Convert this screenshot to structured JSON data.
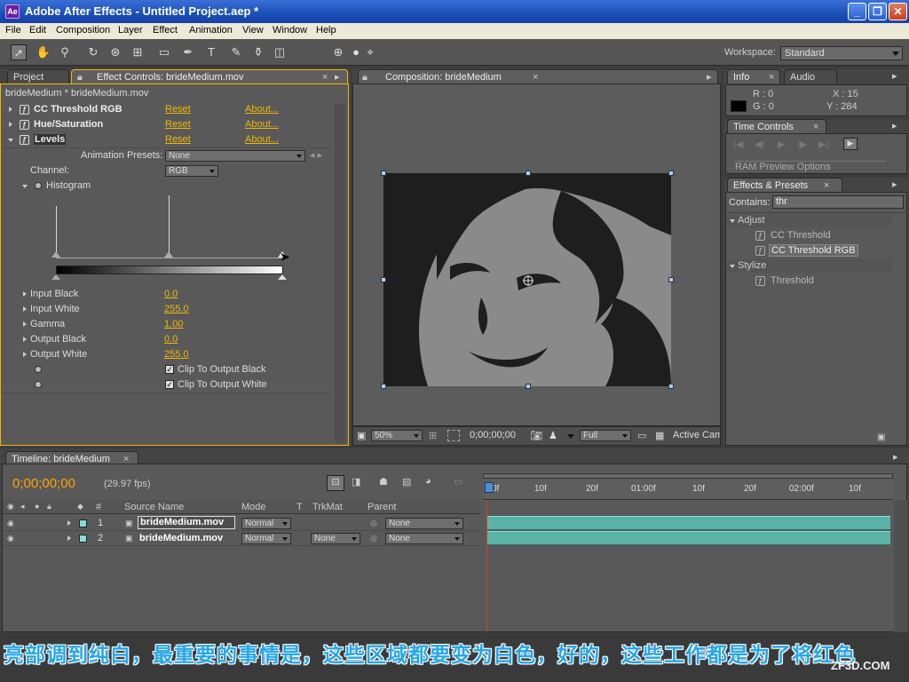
{
  "window": {
    "title": "Adobe After Effects - Untitled Project.aep *",
    "icon": "after-effects-icon"
  },
  "menu": [
    "File",
    "Edit",
    "Composition",
    "Layer",
    "Effect",
    "Animation",
    "View",
    "Window",
    "Help"
  ],
  "toolbar": {
    "workspace_label": "Workspace:",
    "workspace_value": "Standard"
  },
  "project_panel": {
    "tab_project": "Project",
    "tab_effect_controls": "Effect Controls: brideMedium.mov",
    "path": "brideMedium * brideMedium.mov",
    "effects": [
      {
        "name": "CC Threshold RGB",
        "reset": "Reset",
        "about": "About..."
      },
      {
        "name": "Hue/Saturation",
        "reset": "Reset",
        "about": "About..."
      },
      {
        "name": "Levels",
        "reset": "Reset",
        "about": "About..."
      }
    ],
    "animation_presets_label": "Animation Presets:",
    "animation_presets_value": "None",
    "channel_label": "Channel:",
    "channel_value": "RGB",
    "histogram_label": "Histogram",
    "params": [
      {
        "label": "Input Black",
        "value": "0.0"
      },
      {
        "label": "Input White",
        "value": "255.0"
      },
      {
        "label": "Gamma",
        "value": "1.00"
      },
      {
        "label": "Output Black",
        "value": "0.0"
      },
      {
        "label": "Output White",
        "value": "255.0"
      }
    ],
    "clip_black": "Clip To Output Black",
    "clip_white": "Clip To Output White"
  },
  "composition": {
    "tab": "Composition: brideMedium",
    "zoom": "50%",
    "timecode": "0;00;00;00",
    "resolution": "Full",
    "camera": "Active Cam"
  },
  "info_panel": {
    "tab_info": "Info",
    "tab_audio": "Audio",
    "r": "R : 0",
    "g": "G : 0",
    "x": "X : 15",
    "y": "Y : 284"
  },
  "time_controls": {
    "tab": "Time Controls",
    "ram_preview": "RAM Preview Options"
  },
  "effects_presets": {
    "tab": "Effects & Presets",
    "contains_label": "Contains:",
    "search_value": "thr",
    "groups": [
      {
        "name": "Adjust",
        "items": [
          "CC Threshold",
          "CC Threshold RGB"
        ]
      },
      {
        "name": "Stylize",
        "items": [
          "Threshold"
        ]
      }
    ]
  },
  "timeline": {
    "tab": "Timeline: brideMedium",
    "timecode": "0;00;00;00",
    "fps": "(29.97 fps)",
    "columns": {
      "num": "#",
      "source": "Source Name",
      "mode": "Mode",
      "t": "T",
      "trkmat": "TrkMat",
      "parent": "Parent"
    },
    "ruler": [
      "0f",
      "10f",
      "20f",
      "01:00f",
      "10f",
      "20f",
      "02:00f",
      "10f"
    ],
    "layers": [
      {
        "num": "1",
        "name": "brideMedium.mov",
        "mode": "Normal",
        "trkmat": "",
        "parent": "None"
      },
      {
        "num": "2",
        "name": "brideMedium.mov",
        "mode": "Normal",
        "trkmat": "None",
        "parent": "None"
      }
    ]
  },
  "subtitle": "亮部调到纯白，最重要的事情是，这些区域都要变为白色，好的，这些工作都是为了将红色",
  "watermark": "ZF3D.COM",
  "colors": {
    "accent_yellow": "#f2b705",
    "timecode_orange": "#ffa000",
    "track_teal": "#5bb2a6",
    "subtitle_blue": "#27a6e8"
  }
}
